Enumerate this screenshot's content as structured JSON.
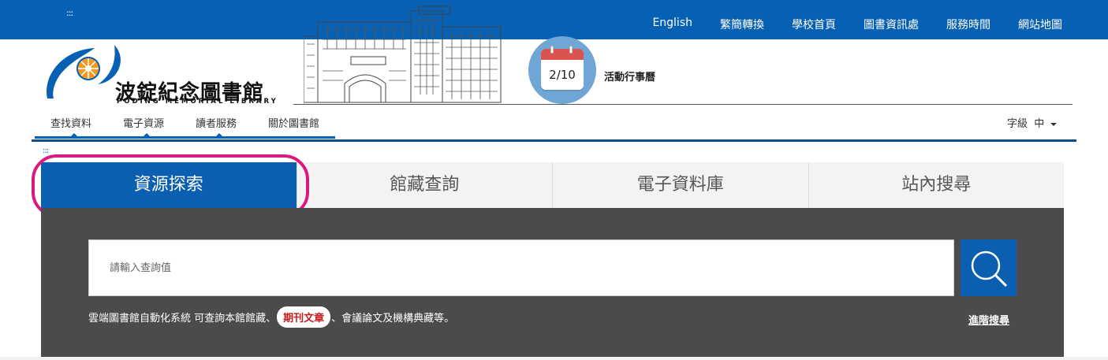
{
  "skip_link": ":::",
  "topnav": [
    {
      "label": "English"
    },
    {
      "label": "繁簡轉換"
    },
    {
      "label": "學校首頁"
    },
    {
      "label": "圖書資訊處"
    },
    {
      "label": "服務時間"
    },
    {
      "label": "網站地圖"
    }
  ],
  "logo": {
    "title": "波錠紀念圖書館",
    "subtitle": "PODING MEMORIAL LIBRARY"
  },
  "calendar": {
    "date": "2/10",
    "label": "活動行事曆"
  },
  "mainnav": [
    {
      "label": "查找資料"
    },
    {
      "label": "電子資源"
    },
    {
      "label": "讀者服務"
    },
    {
      "label": "關於圖書館"
    }
  ],
  "font_size": {
    "label": "字級",
    "value": "中"
  },
  "tabs": [
    {
      "label": "資源探索",
      "active": true
    },
    {
      "label": "館藏查詢",
      "active": false
    },
    {
      "label": "電子資料庫",
      "active": false
    },
    {
      "label": "站內搜尋",
      "active": false
    }
  ],
  "search": {
    "placeholder": "請輸入查詢值"
  },
  "description": {
    "before": "雲端圖書館自動化系統 可查詢本館館藏、",
    "highlight": "期刊文章",
    "after": "、會議論文及機構典藏等。"
  },
  "advanced_search": "進階搜尋",
  "colors": {
    "brand_blue": "#0660b4",
    "panel_gray": "#4b4b4b",
    "highlight_ring": "#d81b7e",
    "pill_text": "#c31d1d"
  }
}
